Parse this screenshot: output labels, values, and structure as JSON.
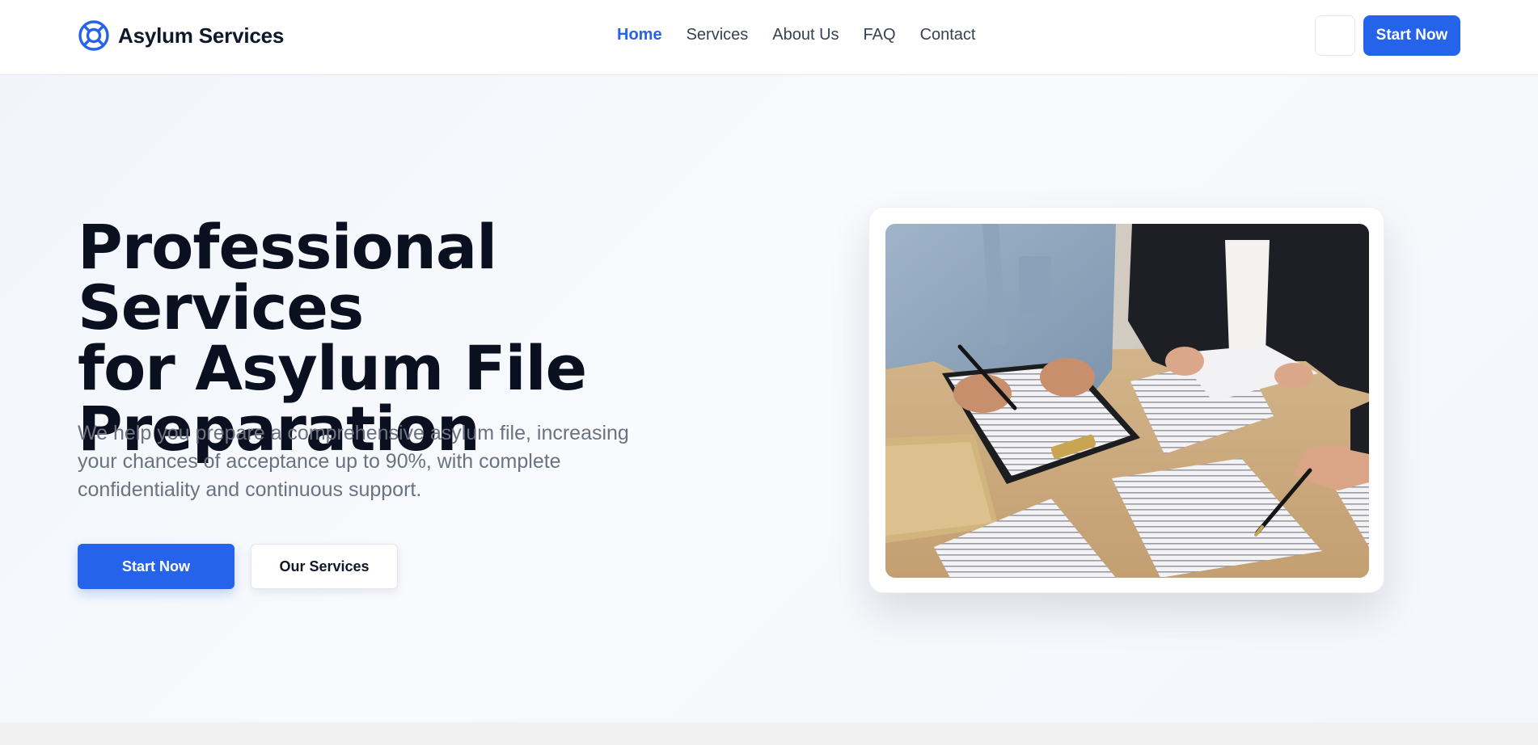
{
  "header": {
    "brand_name": "Asylum Services",
    "brand_icon": "lifebuoy-icon",
    "nav": [
      {
        "label": "Home",
        "active": true
      },
      {
        "label": "Services",
        "active": false
      },
      {
        "label": "About Us",
        "active": false
      },
      {
        "label": "FAQ",
        "active": false
      },
      {
        "label": "Contact",
        "active": false
      }
    ],
    "cta_label": "Start Now"
  },
  "hero": {
    "title_lines": [
      "Professional Services",
      "for Asylum File",
      "Preparation"
    ],
    "subtitle_lines": [
      "We help you prepare a comprehensive asylum file, increasing",
      "your chances of acceptance up to 90%, with complete",
      "confidentiality and continuous support."
    ],
    "primary_button": "Start Now",
    "secondary_button": "Our Services"
  },
  "colors": {
    "accent": "#2563eb",
    "heading": "#0b1020",
    "muted_text": "#6b7280"
  }
}
